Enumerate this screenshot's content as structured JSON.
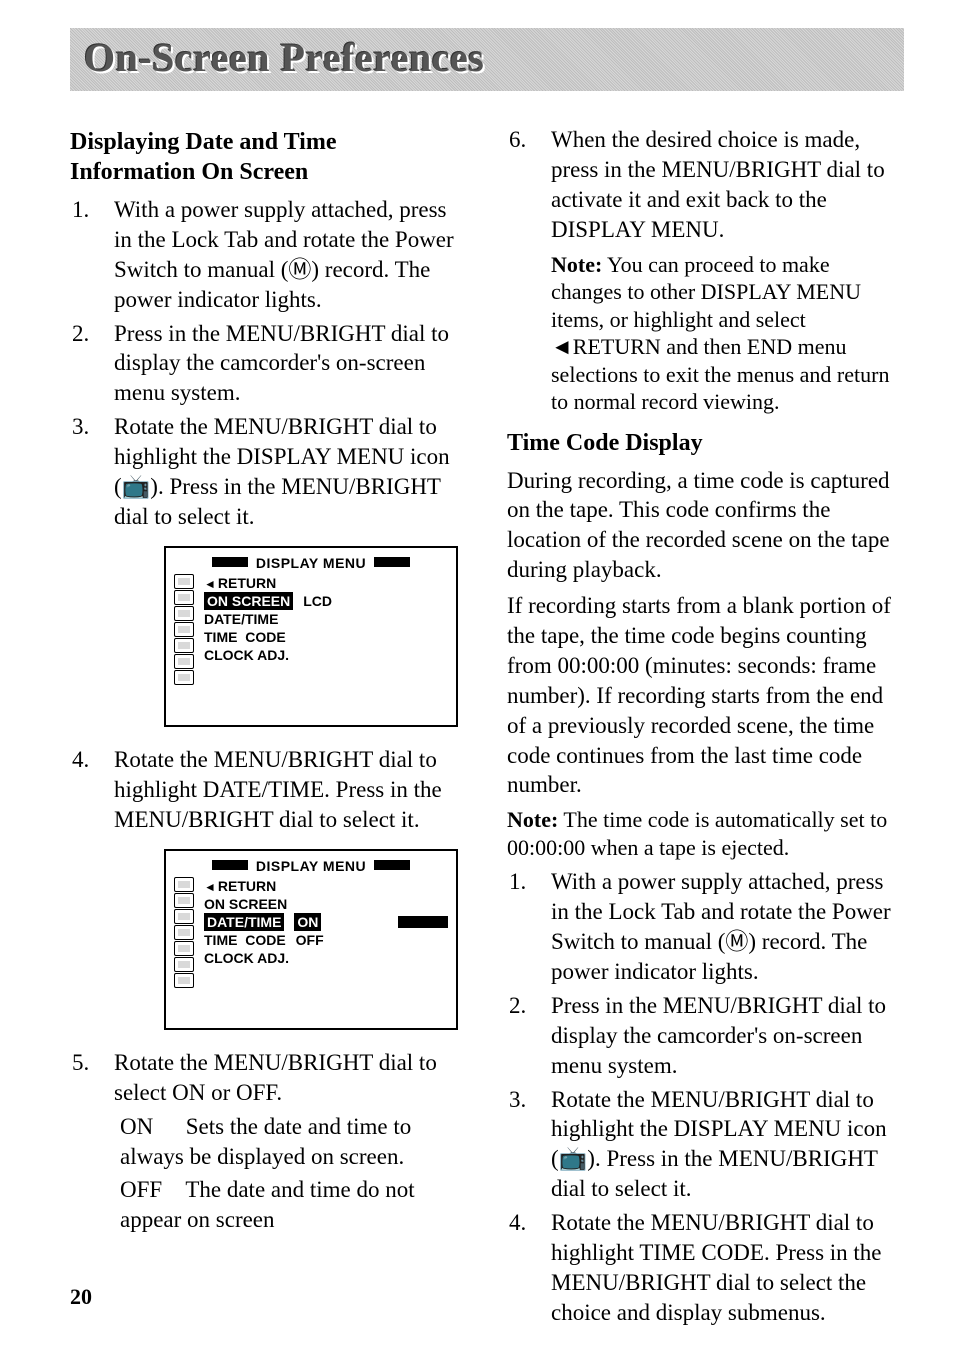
{
  "banner": {
    "title": "On-Screen Preferences"
  },
  "pageNumber": "20",
  "left": {
    "heading": "Displaying Date and Time Information On Screen",
    "steps": [
      "With a power supply attached, press in the Lock Tab and rotate the Power Switch to manual (Ⓜ) record. The power indicator lights.",
      "Press in the MENU/BRIGHT dial to display the camcorder's on-screen menu system.",
      "Rotate the MENU/BRIGHT dial to highlight the DISPLAY MENU icon (📺). Press in the MENU/BRIGHT dial to select it.",
      "Rotate the MENU/BRIGHT dial to highlight DATE/TIME. Press in the MENU/BRIGHT dial to select it.",
      "Rotate the MENU/BRIGHT dial to select ON or OFF."
    ],
    "options": {
      "on": {
        "key": "ON",
        "desc": "Sets the date and time to always be displayed on screen."
      },
      "off": {
        "key": "OFF",
        "desc": "The date and time do not appear on screen"
      }
    }
  },
  "osd1": {
    "title": "DISPLAY MENU",
    "rows": [
      {
        "label": "RETURN",
        "value": "",
        "selected": false,
        "return": true
      },
      {
        "label": "ON SCREEN",
        "value": "LCD",
        "selected": true
      },
      {
        "label": "DATE/TIME",
        "value": "",
        "selected": false
      },
      {
        "label": "TIME  CODE",
        "value": "",
        "selected": false
      },
      {
        "label": "CLOCK ADJ.",
        "value": "",
        "selected": false
      }
    ]
  },
  "osd2": {
    "title": "DISPLAY MENU",
    "rows": [
      {
        "label": "RETURN",
        "value": "",
        "selected": false,
        "return": true
      },
      {
        "label": "ON SCREEN",
        "value": "",
        "selected": false
      },
      {
        "label": "DATE/TIME",
        "value": "ON",
        "selected": true,
        "valSelected": true,
        "blackbar": true
      },
      {
        "label": "TIME  CODE",
        "value": "OFF",
        "selected": false
      },
      {
        "label": "CLOCK ADJ.",
        "value": "",
        "selected": false
      }
    ]
  },
  "right": {
    "step6": "When the desired choice is made, press in the MENU/BRIGHT dial to activate it and exit back to the DISPLAY MENU.",
    "note1": {
      "label": "Note:",
      "text": "You can proceed to make changes to other DISPLAY MENU items, or highlight and select ◄RETURN and then END menu selections to exit the menus and return to normal record viewing."
    },
    "heading2": "Time Code Display",
    "para1": "During recording, a time code is captured on the tape. This code confirms the location of the recorded scene on the tape during playback.",
    "para2": "If recording starts from a blank portion of the tape, the time code begins counting from 00:00:00 (minutes: seconds: frame number). If recording starts from the end of a previously recorded scene, the time code continues from the last time code number.",
    "note2": {
      "label": "Note:",
      "text": "The time code is automatically set to 00:00:00 when a tape is ejected."
    },
    "steps": [
      "With a power supply attached, press in the Lock Tab and rotate the Power Switch to manual (Ⓜ) record. The power indicator lights.",
      "Press in the MENU/BRIGHT dial to display the camcorder's on-screen menu system.",
      "Rotate the MENU/BRIGHT dial to highlight the DISPLAY MENU icon (📺). Press in the MENU/BRIGHT dial to select it.",
      "Rotate the MENU/BRIGHT dial to highlight TIME CODE. Press in the MENU/BRIGHT dial to select the choice and display submenus."
    ]
  }
}
